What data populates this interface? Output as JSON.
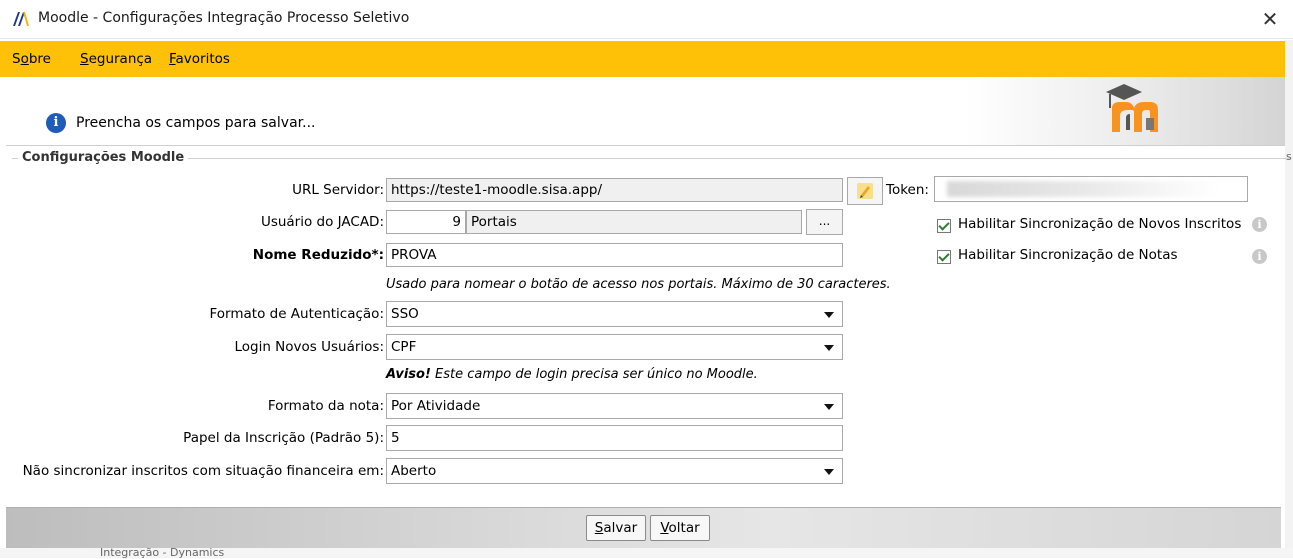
{
  "window": {
    "title": "Moodle - Configurações Integração Processo Seletivo",
    "close_label": "✕"
  },
  "menu": {
    "items": [
      {
        "pre": "S",
        "accel": "o",
        "post": "bre"
      },
      {
        "pre": "",
        "accel": "S",
        "post": "egurança"
      },
      {
        "pre": "",
        "accel": "F",
        "post": "avoritos"
      }
    ]
  },
  "info": {
    "icon_glyph": "i",
    "message": "Preencha os campos para salvar..."
  },
  "group": {
    "title": "Configurações Moodle"
  },
  "form": {
    "url_label": "URL Servidor:",
    "url_value": "https://teste1-moodle.sisa.app/",
    "token_label": "Token:",
    "token_value": "",
    "user_label": "Usuário do JACAD:",
    "user_id": "9",
    "user_name": "Portais",
    "user_lookup_label": "...",
    "short_name_label": "Nome Reduzido*:",
    "short_name_value": "PROVA",
    "short_name_hint": "Usado para nomear o botão de acesso nos portais. Máximo de 30 caracteres.",
    "auth_label": "Formato de Autenticação:",
    "auth_value": "SSO",
    "login_label": "Login Novos Usuários:",
    "login_value": "CPF",
    "login_warning_bold": "Aviso!",
    "login_warning_text": " Este campo de login precisa ser único no Moodle.",
    "grade_label": "Formato da nota:",
    "grade_value": "Por Atividade",
    "role_label": "Papel da Inscrição (Padrão 5):",
    "role_value": "5",
    "finance_label": "Não sincronizar inscritos com situação financeira em:",
    "finance_value": "Aberto",
    "sync_new_label": "Habilitar Sincronização de Novos Inscritos",
    "sync_new_checked": true,
    "sync_grades_label": "Habilitar Sincronização de Notas",
    "sync_grades_checked": true
  },
  "buttons": {
    "save": {
      "accel": "S",
      "post": "alvar"
    },
    "back": {
      "accel": "V",
      "post": "oltar"
    }
  },
  "background": {
    "bottom_text": "Integração - Dynamics",
    "edge_char": "s"
  },
  "colors": {
    "menubar": "#ffc107",
    "info_icon": "#1f5bb8",
    "moodle_orange": "#f7931e"
  }
}
